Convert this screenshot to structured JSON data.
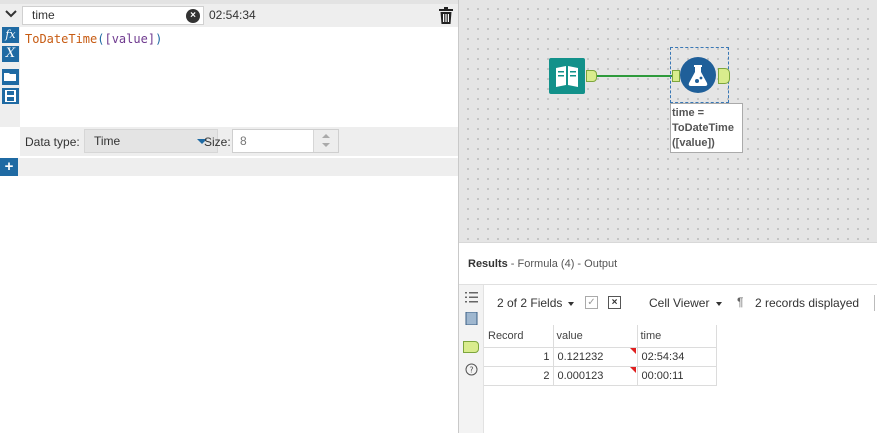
{
  "formula": {
    "field_name": "time",
    "preview_value": "02:54:34",
    "expression_fn": "ToDateTime",
    "expression_open": "(",
    "expression_field": "[value]",
    "expression_close": ")",
    "data_type_label": "Data type:",
    "data_type_value": "Time",
    "size_label": "Size:",
    "size_value": "8",
    "side_tools": [
      "fx",
      "X",
      "open",
      "save"
    ],
    "add_label": "+"
  },
  "canvas": {
    "annotation_lines": [
      "time =",
      "ToDateTime",
      "([value])"
    ]
  },
  "results": {
    "title": "Results",
    "subtitle": " - Formula (4) - Output",
    "fields_count": "2 of 2 Fields",
    "cell_viewer": "Cell Viewer",
    "pilcrow": "¶",
    "records_displayed": "2 records displayed",
    "columns": [
      "Record",
      "value",
      "time"
    ],
    "rows": [
      {
        "record": "1",
        "value": "0.121232",
        "time": "02:54:34"
      },
      {
        "record": "2",
        "value": "0.000123",
        "time": "00:00:11"
      }
    ]
  },
  "colors": {
    "accent": "#1f6aa3",
    "input_tool": "#12918a",
    "formula_tool": "#1f5f99",
    "connection": "#2e9a3c",
    "anchor": "#d9ec8d",
    "truncation_flag": "#e02020"
  }
}
